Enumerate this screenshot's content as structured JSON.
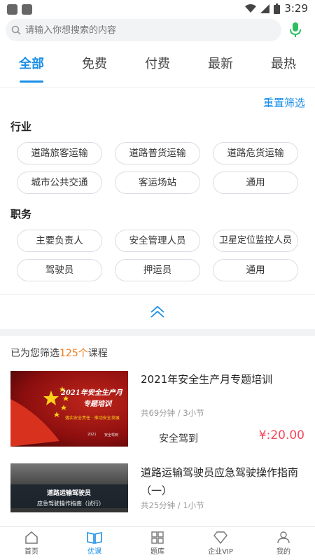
{
  "status": {
    "time": "3:29"
  },
  "search": {
    "placeholder": "请输入你想搜索的内容"
  },
  "tabs": [
    {
      "label": "全部"
    },
    {
      "label": "免费"
    },
    {
      "label": "付费"
    },
    {
      "label": "最新"
    },
    {
      "label": "最热"
    }
  ],
  "filter": {
    "reset_label": "重置筛选",
    "industry": {
      "title": "行业",
      "options": [
        "道路旅客运输",
        "道路普货运输",
        "道路危货运输",
        "城市公共交通",
        "客运场站",
        "通用"
      ]
    },
    "position": {
      "title": "职务",
      "options": [
        "主要负责人",
        "安全管理人员",
        "卫星定位监控人员",
        "驾驶员",
        "押运员",
        "通用"
      ]
    }
  },
  "result": {
    "prefix": "已为您筛选",
    "count": "125个",
    "suffix": "课程"
  },
  "courses": [
    {
      "title": "2021年安全生产月专题培训",
      "meta": "共69分钟 / 3小节",
      "tag": "安全驾到",
      "price": "¥:20.00",
      "thumb_line1": "2021年安全生产月",
      "thumb_line2": "专题培训",
      "thumb_line3": "落实安全责任 · 推动安全发展",
      "thumb_year": "2021",
      "thumb_brand": "安全驾到"
    },
    {
      "title": "道路运输驾驶员应急驾驶操作指南（一）",
      "meta": "共25分钟 / 1小节",
      "thumb_line1": "道路运输驾驶员",
      "thumb_line2": "应急驾驶操作指南（试行）"
    }
  ],
  "bottom_nav": [
    {
      "label": "首页"
    },
    {
      "label": "优课"
    },
    {
      "label": "题库"
    },
    {
      "label": "企业VIP"
    },
    {
      "label": "我的"
    }
  ],
  "colors": {
    "accent": "#1a8fe8",
    "price": "#f5485c",
    "count": "#f07a1a",
    "mic": "#2dbe60"
  }
}
